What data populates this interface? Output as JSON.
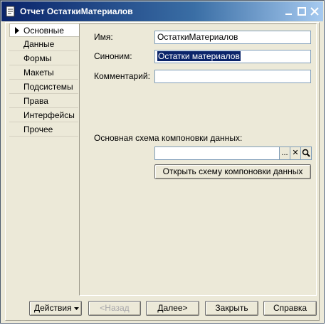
{
  "window": {
    "title": "Отчет ОстаткиМатериалов"
  },
  "nav": {
    "items": [
      {
        "label": "Основные",
        "active": true
      },
      {
        "label": "Данные"
      },
      {
        "label": "Формы"
      },
      {
        "label": "Макеты"
      },
      {
        "label": "Подсистемы"
      },
      {
        "label": "Права"
      },
      {
        "label": "Интерфейсы"
      },
      {
        "label": "Прочее"
      }
    ]
  },
  "main": {
    "name_label": "Имя:",
    "name_value": "ОстаткиМатериалов",
    "synonym_label": "Синоним:",
    "synonym_value": "Остатки материалов",
    "comment_label": "Комментарий:",
    "comment_value": "",
    "schema_label": "Основная схема компоновки данных:",
    "schema_value": "",
    "open_schema_label": "Открыть схему компоновки данных",
    "select_btn": "...",
    "clear_btn": "✕",
    "open_btn_icon": "magnifier-icon"
  },
  "footer": {
    "actions_label": "Действия",
    "back_label": "<Назад",
    "next_label": "Далее>",
    "close_label": "Закрыть",
    "help_label": "Справка"
  },
  "colors": {
    "titlebar_start": "#0a246a",
    "titlebar_end": "#a6caf0",
    "window_bg": "#ece9d8",
    "selection": "#0a246a"
  }
}
